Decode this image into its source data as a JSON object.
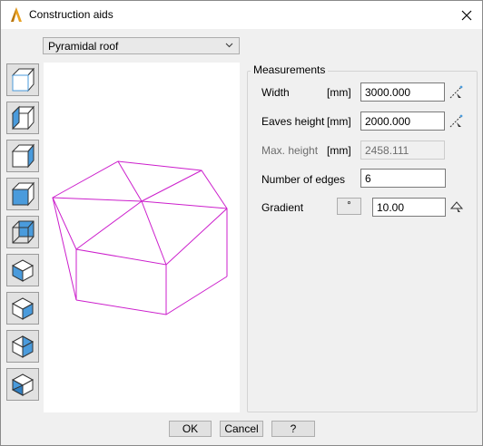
{
  "window": {
    "title": "Construction aids"
  },
  "type_select": {
    "value": "Pyramidal roof"
  },
  "toolbar": {
    "items": [
      {
        "icon": "cube-outline-icon"
      },
      {
        "icon": "cube-left-face-icon"
      },
      {
        "icon": "cube-right-face-icon"
      },
      {
        "icon": "cube-front-face-icon"
      },
      {
        "icon": "cube-back-face-icon"
      },
      {
        "icon": "iso-cube-left-icon"
      },
      {
        "icon": "iso-cube-right-icon"
      },
      {
        "icon": "iso-cube-top-right-icon"
      },
      {
        "icon": "iso-cube-bottom-left-icon"
      }
    ]
  },
  "measurements": {
    "title": "Measurements",
    "width": {
      "label": "Width",
      "unit": "[mm]",
      "value": "3000.000"
    },
    "eaves_height": {
      "label": "Eaves height",
      "unit": "[mm]",
      "value": "2000.000"
    },
    "max_height": {
      "label": "Max. height",
      "unit": "[mm]",
      "value": "2458.111"
    },
    "edges": {
      "label": "Number of edges",
      "value": "6"
    },
    "gradient": {
      "label": "Gradient",
      "unit_button": "°",
      "value": "10.00"
    }
  },
  "buttons": {
    "ok": "OK",
    "cancel": "Cancel",
    "help": "?"
  },
  "colors": {
    "wireframe": "#cc1fcc",
    "accent": "#4a9bdc",
    "app_icon": "#e8a020"
  }
}
